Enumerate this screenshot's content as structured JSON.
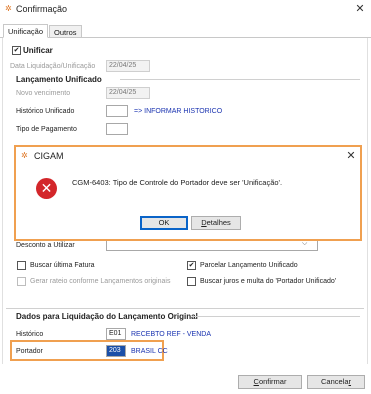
{
  "window": {
    "title": "Confirmação"
  },
  "tabs": [
    {
      "label": "Unificação"
    },
    {
      "label": "Outros"
    }
  ],
  "unificar": {
    "label": "Unificar"
  },
  "data_liquidacao": {
    "label": "Data Liquidação/Unificação",
    "value": "22/04/25"
  },
  "lancamento": {
    "heading": "Lançamento Unificado",
    "novo_vencimento_label": "Novo vencimento",
    "novo_vencimento_value": "22/04/25",
    "historico_label": "Histórico Unificado",
    "historico_hint": "=> INFORMAR HISTORICO",
    "tipo_pagamento_label": "Tipo de Pagamento"
  },
  "desconto": {
    "label": "Desconto a Utilizar"
  },
  "options": {
    "buscar_ultima": "Buscar última Fatura",
    "parcelar": "Parcelar Lançamento Unificado",
    "gerar_rateio": "Gerar rateio conforme Lançamentos originais",
    "buscar_juros": "Buscar juros e multa do 'Portador Unificado'"
  },
  "dados": {
    "heading": "Dados para Liquidação do Lançamento Original",
    "historico_label": "Histórico",
    "historico_code": "E01",
    "historico_desc": "RECEBTO REF - VENDA",
    "portador_label": "Portador",
    "portador_code": "203",
    "portador_desc": "BRASIL CC"
  },
  "footer": {
    "confirmar_prefix": "C",
    "confirmar_rest": "onfirmar",
    "cancelar_main": "Cancela",
    "cancelar_suffix": "r"
  },
  "dialog": {
    "title": "CIGAM",
    "message": "CGM-6403: Tipo de Controle do Portador deve ser 'Unificação'.",
    "ok_label": "OK",
    "detalhes_prefix": "D",
    "detalhes_rest": "etalhes"
  }
}
